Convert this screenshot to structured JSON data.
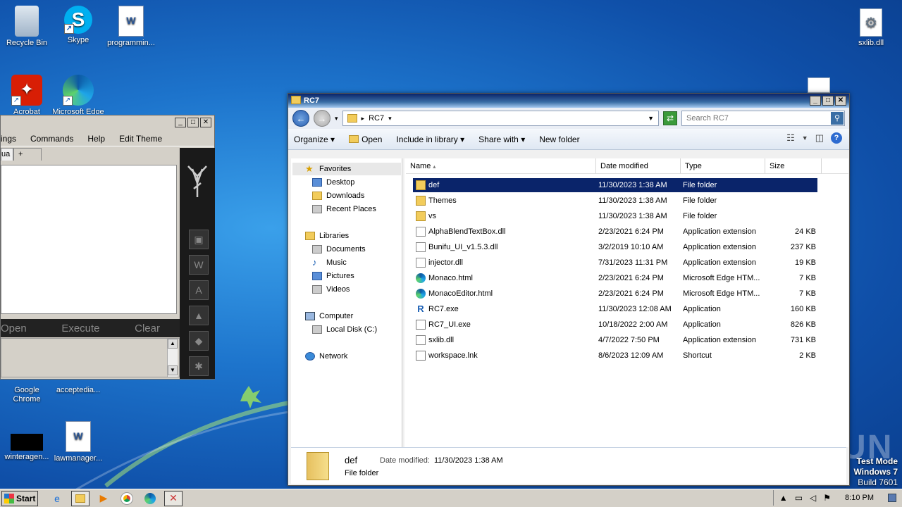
{
  "desktop": {
    "icons": [
      {
        "label": "Recycle Bin"
      },
      {
        "label": "Skype"
      },
      {
        "label": "programmin..."
      },
      {
        "label": "Acrobat"
      },
      {
        "label": "Microsoft Edge"
      },
      {
        "label": "Google Chrome"
      },
      {
        "label": "acceptedia..."
      },
      {
        "label": "winteragen..."
      },
      {
        "label": "lawmanager..."
      },
      {
        "label": "sxlib.dll"
      }
    ],
    "watermark": "ANY.RUN",
    "test_mode": {
      "line1": "Test Mode",
      "line2": "Windows 7",
      "line3": "Build 7601"
    }
  },
  "rc7": {
    "menu": [
      "ings",
      "Commands",
      "Help",
      "Edit Theme"
    ],
    "tabs": [
      "ua",
      "+"
    ],
    "actions": {
      "open": "Open",
      "execute": "Execute",
      "clear": "Clear"
    },
    "logo": "RC7"
  },
  "explorer": {
    "title": "RC7",
    "address": {
      "crumb": "RC7"
    },
    "search": {
      "placeholder": "Search RC7"
    },
    "toolbar": {
      "organize": "Organize",
      "open": "Open",
      "include": "Include in library",
      "share": "Share with",
      "new_folder": "New folder"
    },
    "nav": {
      "favorites": "Favorites",
      "desktop": "Desktop",
      "downloads": "Downloads",
      "recent": "Recent Places",
      "libraries": "Libraries",
      "documents": "Documents",
      "music": "Music",
      "pictures": "Pictures",
      "videos": "Videos",
      "computer": "Computer",
      "local_disk": "Local Disk (C:)",
      "network": "Network"
    },
    "columns": {
      "name": "Name",
      "date": "Date modified",
      "type": "Type",
      "size": "Size"
    },
    "files": [
      {
        "name": "def",
        "date": "11/30/2023 1:38 AM",
        "type": "File folder",
        "size": "",
        "icon": "folder"
      },
      {
        "name": "Themes",
        "date": "11/30/2023 1:38 AM",
        "type": "File folder",
        "size": "",
        "icon": "folder"
      },
      {
        "name": "vs",
        "date": "11/30/2023 1:38 AM",
        "type": "File folder",
        "size": "",
        "icon": "folder"
      },
      {
        "name": "AlphaBlendTextBox.dll",
        "date": "2/23/2021 6:24 PM",
        "type": "Application extension",
        "size": "24 KB",
        "icon": "dll"
      },
      {
        "name": "Bunifu_UI_v1.5.3.dll",
        "date": "3/2/2019 10:10 AM",
        "type": "Application extension",
        "size": "237 KB",
        "icon": "dll"
      },
      {
        "name": "injector.dll",
        "date": "7/31/2023 11:31 PM",
        "type": "Application extension",
        "size": "19 KB",
        "icon": "dll"
      },
      {
        "name": "Monaco.html",
        "date": "2/23/2021 6:24 PM",
        "type": "Microsoft Edge HTM...",
        "size": "7 KB",
        "icon": "edge"
      },
      {
        "name": "MonacoEditor.html",
        "date": "2/23/2021 6:24 PM",
        "type": "Microsoft Edge HTM...",
        "size": "7 KB",
        "icon": "edge"
      },
      {
        "name": "RC7.exe",
        "date": "11/30/2023 12:08 AM",
        "type": "Application",
        "size": "160 KB",
        "icon": "rc"
      },
      {
        "name": "RC7_UI.exe",
        "date": "10/18/2022 2:00 AM",
        "type": "Application",
        "size": "826 KB",
        "icon": "exe"
      },
      {
        "name": "sxlib.dll",
        "date": "4/7/2022 7:50 PM",
        "type": "Application extension",
        "size": "731 KB",
        "icon": "dll"
      },
      {
        "name": "workspace.lnk",
        "date": "8/6/2023 12:09 AM",
        "type": "Shortcut",
        "size": "2 KB",
        "icon": "lnk"
      }
    ],
    "details": {
      "name": "def",
      "modified_label": "Date modified:",
      "modified_value": "11/30/2023 1:38 AM",
      "type": "File folder"
    }
  },
  "taskbar": {
    "start": "Start",
    "clock": "8:10 PM"
  }
}
